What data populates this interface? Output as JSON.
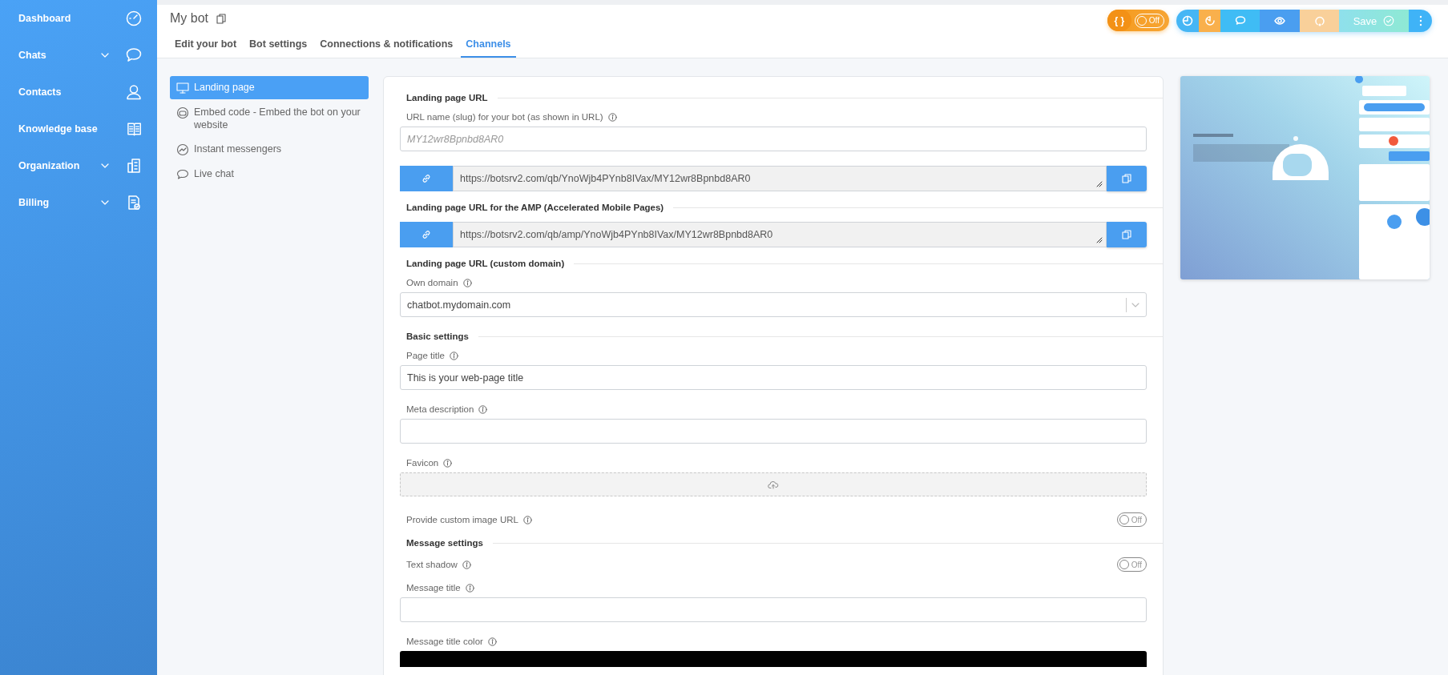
{
  "sidebar": {
    "items": [
      {
        "label": "Dashboard",
        "expandable": false
      },
      {
        "label": "Chats",
        "expandable": true
      },
      {
        "label": "Contacts",
        "expandable": false
      },
      {
        "label": "Knowledge base",
        "expandable": false
      },
      {
        "label": "Organization",
        "expandable": true
      },
      {
        "label": "Billing",
        "expandable": true
      }
    ]
  },
  "header": {
    "title": "My bot",
    "tabs": [
      {
        "label": "Edit your bot",
        "selected": false
      },
      {
        "label": "Bot settings",
        "selected": false
      },
      {
        "label": "Connections & notifications",
        "selected": false
      },
      {
        "label": "Channels",
        "selected": true
      }
    ]
  },
  "toolbar": {
    "code_button": "{ }",
    "code_toggle": {
      "label": "Off",
      "on": false
    },
    "save_label": "Save"
  },
  "channels_menu": [
    {
      "label": "Landing page",
      "selected": true
    },
    {
      "label": "Embed code - Embed the bot on your website",
      "selected": false
    },
    {
      "label": "Instant messengers",
      "selected": false
    },
    {
      "label": "Live chat",
      "selected": false
    }
  ],
  "form": {
    "sections": [
      {
        "title": "Landing page URL",
        "fields": [
          {
            "kind": "text",
            "label": "URL name (slug) for your bot (as shown in URL)",
            "placeholder": "MY12wr8Bpnbd8AR0"
          },
          {
            "kind": "link",
            "value": "https://botsrv2.com/qb/YnoWjb4PYnb8IVax/MY12wr8Bpnbd8AR0"
          }
        ]
      },
      {
        "title": "Landing page URL for the AMP (Accelerated Mobile Pages)",
        "fields": [
          {
            "kind": "link",
            "value": "https://botsrv2.com/qb/amp/YnoWjb4PYnb8IVax/MY12wr8Bpnbd8AR0"
          }
        ]
      },
      {
        "title": "Landing page URL (custom domain)",
        "fields": [
          {
            "kind": "select",
            "label": "Own domain",
            "value": "chatbot.mydomain.com"
          }
        ]
      },
      {
        "title": "Basic settings",
        "fields": [
          {
            "kind": "text",
            "label": "Page title",
            "value": "This is your web-page title"
          },
          {
            "kind": "text",
            "label": "Meta description"
          },
          {
            "kind": "upload",
            "label": "Favicon"
          },
          {
            "kind": "toggle",
            "label": "Provide custom image URL",
            "toggle_label": "Off",
            "on": false
          }
        ]
      },
      {
        "title": "Message settings",
        "fields": [
          {
            "kind": "toggle",
            "label": "Text shadow",
            "toggle_label": "Off",
            "on": false
          },
          {
            "kind": "text",
            "label": "Message title"
          },
          {
            "kind": "color",
            "label": "Message title color",
            "color": "#000000"
          }
        ]
      }
    ]
  }
}
